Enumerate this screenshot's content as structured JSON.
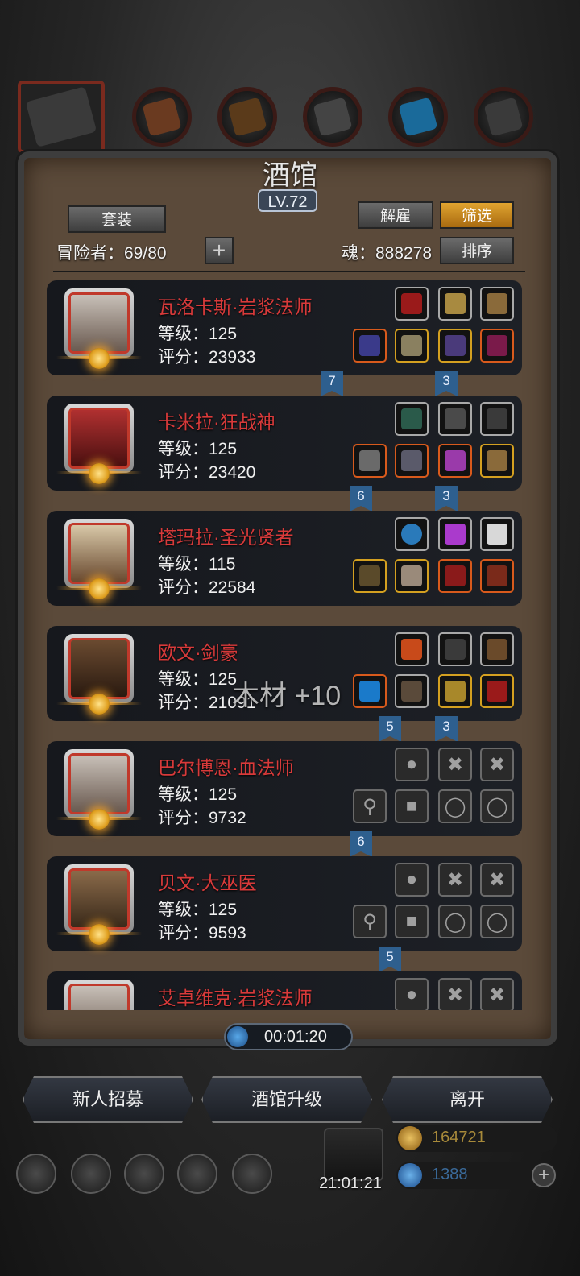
{
  "tavern": {
    "title": "酒馆",
    "level": "LV.72"
  },
  "buttons": {
    "suit": "套装",
    "dismiss": "解雇",
    "filter": "筛选",
    "sort": "排序"
  },
  "status": {
    "adventurers": "冒险者：69/80",
    "soul": "魂：888278"
  },
  "heroes": [
    {
      "name": "瓦洛卡斯·岩浆法师",
      "level": "等级：125",
      "score": "评分：23933",
      "flags": [
        "7",
        "3"
      ],
      "empty": false
    },
    {
      "name": "卡米拉·狂战神",
      "level": "等级：125",
      "score": "评分：23420",
      "flags": [
        "6",
        "3"
      ],
      "empty": false
    },
    {
      "name": "塔玛拉·圣光贤者",
      "level": "等级：115",
      "score": "评分：22584",
      "flags": [],
      "empty": false
    },
    {
      "name": "欧文·剑豪",
      "level": "等级：125",
      "score": "评分：21091",
      "flags": [
        "5",
        "3"
      ],
      "empty": false
    },
    {
      "name": "巴尔博恩·血法师",
      "level": "等级：125",
      "score": "评分：9732",
      "flags": [
        "6"
      ],
      "empty": true
    },
    {
      "name": "贝文·大巫医",
      "level": "等级：125",
      "score": "评分：9593",
      "flags": [
        "5"
      ],
      "empty": true
    },
    {
      "name": "艾卓维克·岩浆法师",
      "level": "",
      "score": "",
      "flags": [],
      "empty": true
    }
  ],
  "floater": "木材 +10",
  "timer": "00:01:20",
  "actions": {
    "recruit": "新人招募",
    "upgrade": "酒馆升级",
    "leave": "离开"
  },
  "gift_timer": "21:01:21",
  "resources": {
    "gold": "164721",
    "gems": "1388"
  },
  "colors": {
    "hero_name": "#d83a3a",
    "filter_gold": "#e0a430",
    "flag_blue": "#2e5f8e"
  }
}
